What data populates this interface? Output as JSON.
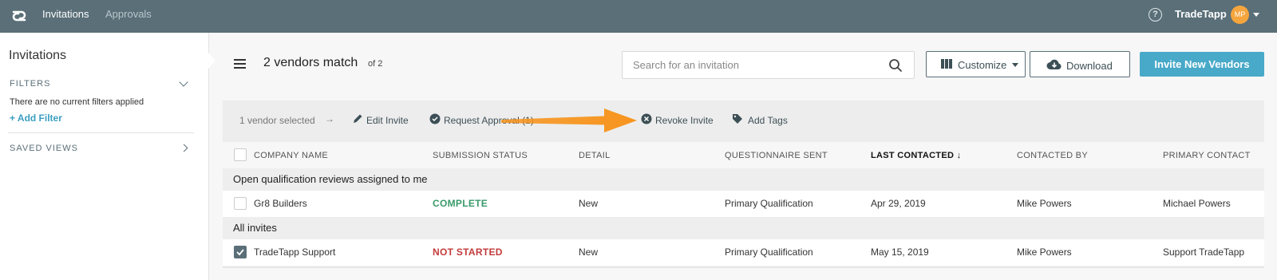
{
  "nav": {
    "items": [
      {
        "label": "Invitations",
        "active": true
      },
      {
        "label": "Approvals",
        "active": false
      }
    ],
    "help_icon": "question-circle-icon",
    "user_name": "TradeTapp",
    "avatar_initials": "MP",
    "colors": {
      "bar": "#5a6f78",
      "avatar": "#f5a53d"
    }
  },
  "sidebar": {
    "title": "Invitations",
    "filters_label": "FILTERS",
    "no_filters_text": "There are no current filters applied",
    "add_filter_label": "+ Add Filter",
    "saved_views_label": "SAVED VIEWS"
  },
  "header": {
    "match_text": "2 vendors match",
    "match_of": "of 2",
    "search_placeholder": "Search for an invitation",
    "customize_label": "Customize",
    "download_label": "Download",
    "invite_label": "Invite New Vendors",
    "accent": "#48a9c9"
  },
  "action_bar": {
    "selected_text": "1 vendor selected",
    "arrow": "→",
    "actions": [
      {
        "label": "Edit Invite",
        "icon": "pencil-icon"
      },
      {
        "label": "Request Approval (1)",
        "icon": "check-circle-icon"
      },
      {
        "label": "Revoke Invite",
        "icon": "x-circle-icon"
      },
      {
        "label": "Add Tags",
        "icon": "tag-icon"
      }
    ]
  },
  "table": {
    "columns": [
      "COMPANY NAME",
      "SUBMISSION STATUS",
      "DETAIL",
      "QUESTIONNAIRE SENT",
      "LAST CONTACTED ↓",
      "CONTACTED BY",
      "PRIMARY CONTACT"
    ],
    "sorted_column": "LAST CONTACTED ↓",
    "groups": [
      {
        "label": "Open qualification reviews assigned to me",
        "rows": [
          {
            "checked": false,
            "company": "Gr8 Builders",
            "status": "COMPLETE",
            "detail": "New",
            "questionnaire": "Primary Qualification",
            "last_contacted": "Apr 29, 2019",
            "contacted_by": "Mike Powers",
            "primary_contact": "Michael Powers"
          }
        ]
      },
      {
        "label": "All invites",
        "rows": [
          {
            "checked": true,
            "company": "TradeTapp Support",
            "status": "NOT STARTED",
            "detail": "New",
            "questionnaire": "Primary Qualification",
            "last_contacted": "May 15, 2019",
            "contacted_by": "Mike Powers",
            "primary_contact": "Support TradeTapp"
          }
        ]
      }
    ],
    "status_colors": {
      "complete": "#3a9a6a",
      "not_started": "#c23b3b"
    }
  },
  "annotation": {
    "icon": "orange-arrow-icon",
    "color": "#f7941d"
  }
}
